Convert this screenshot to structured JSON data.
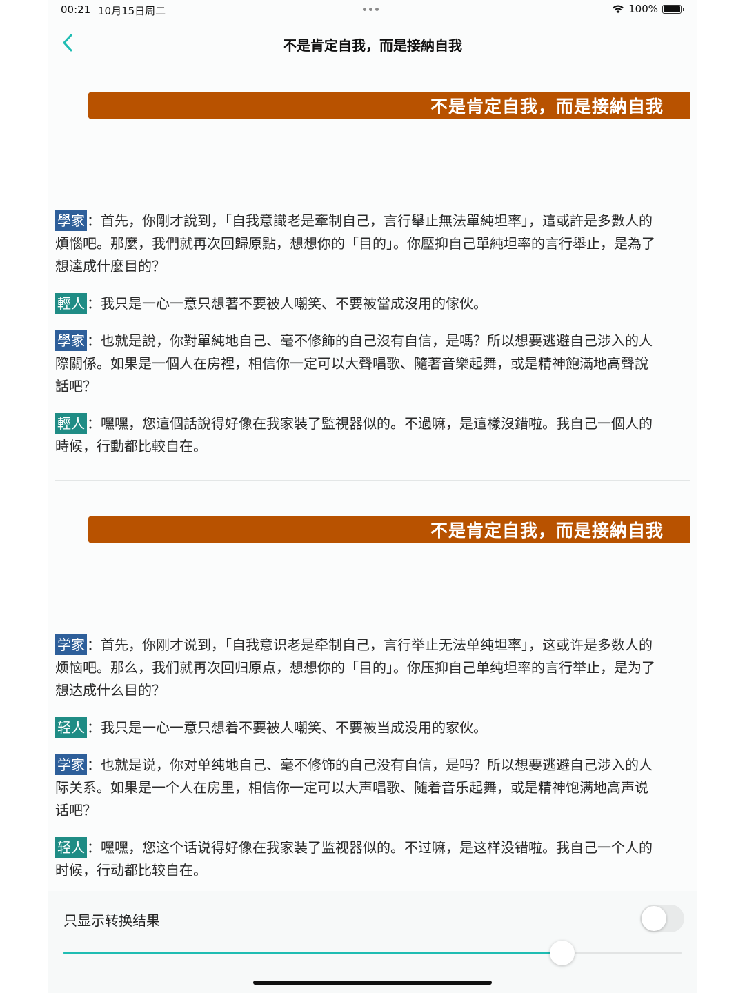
{
  "status_bar": {
    "time": "00:21",
    "date": "10月15日周二",
    "battery": "100%"
  },
  "nav": {
    "title": "不是肯定自我，而是接納自我"
  },
  "colors": {
    "accent": "#1fbdb3",
    "banner": "#b85200",
    "scholar_tag": "#2e5f9a",
    "youth_tag": "#1f8c85"
  },
  "sections": [
    {
      "banner": "不是肯定自我，而是接納自我",
      "paragraphs": [
        {
          "speaker": "學家",
          "role": "scholar",
          "text": "：首先，你剛才說到，「自我意識老是牽制自己，言行舉止無法單純坦率」，這或許是多數人的煩惱吧。那麼，我們就再次回歸原點，想想你的「目的」。你壓抑自己單純坦率的言行舉止，是為了想達成什麼目的？"
        },
        {
          "speaker": "輕人",
          "role": "youth",
          "text": "：我只是一心一意只想著不要被人嘲笑、不要被當成沒用的傢伙。"
        },
        {
          "speaker": "學家",
          "role": "scholar",
          "text": "：也就是說，你對單純地自己、毫不修飾的自己沒有自信，是嗎？所以想要逃避自己涉入的人際關係。如果是一個人在房裡，相信你一定可以大聲唱歌、隨著音樂起舞，或是精神飽滿地高聲說話吧？"
        },
        {
          "speaker": "輕人",
          "role": "youth",
          "text": "：嘿嘿，您這個話說得好像在我家裝了監視器似的。不過嘛，是這樣沒錯啦。我自己一個人的時候，行動都比較自在。"
        }
      ]
    },
    {
      "banner": "不是肯定自我，而是接納自我",
      "paragraphs": [
        {
          "speaker": "学家",
          "role": "scholar",
          "text": "：首先，你刚才说到，「自我意识老是牵制自己，言行举止无法单纯坦率」，这或许是多数人的烦恼吧。那么，我们就再次回归原点，想想你的「目的」。你压抑自己单纯坦率的言行举止，是为了想达成什么目的？"
        },
        {
          "speaker": "轻人",
          "role": "youth",
          "text": "：我只是一心一意只想着不要被人嘲笑、不要被当成没用的家伙。"
        },
        {
          "speaker": "学家",
          "role": "scholar",
          "text": "：也就是说，你对单纯地自己、毫不修饰的自己没有自信，是吗？所以想要逃避自己涉入的人际关系。如果是一个人在房里，相信你一定可以大声唱歌、随着音乐起舞，或是精神饱满地高声说话吧？"
        },
        {
          "speaker": "轻人",
          "role": "youth",
          "text": "：嘿嘿，您这个话说得好像在我家装了监视器似的。不过嘛，是这样没错啦。我自己一个人的时候，行动都比较自在。"
        }
      ]
    }
  ],
  "controls": {
    "toggle_label": "只显示转换结果",
    "toggle_on": false,
    "slider_value": 0.807
  }
}
